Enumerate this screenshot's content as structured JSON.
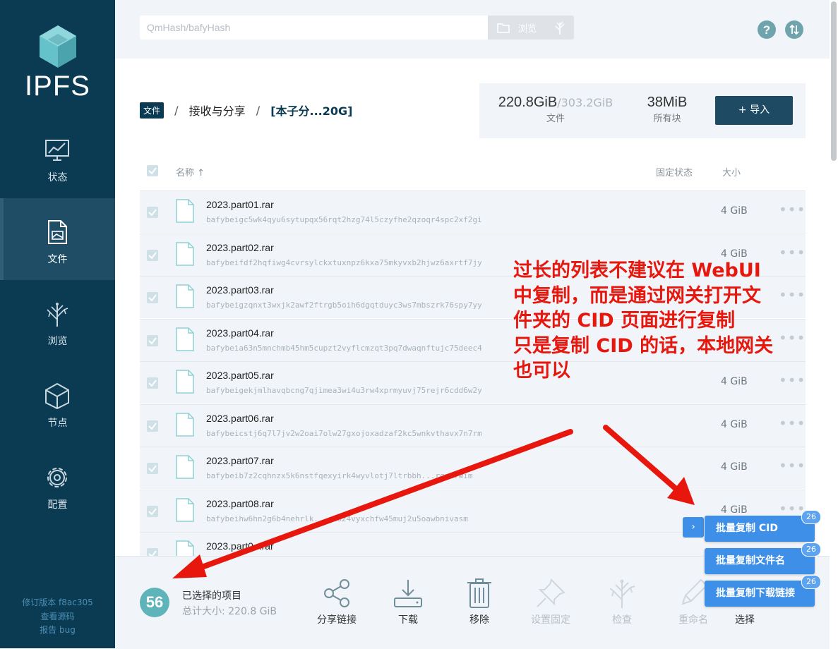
{
  "sidebar": {
    "logo_text": "IPFS",
    "items": [
      {
        "label": "状态",
        "icon": "status-chart-icon"
      },
      {
        "label": "文件",
        "icon": "file-icon"
      },
      {
        "label": "浏览",
        "icon": "tree-icon"
      },
      {
        "label": "节点",
        "icon": "cube-icon"
      },
      {
        "label": "配置",
        "icon": "gear-icon"
      }
    ],
    "version_line": "修订版本 f8ac305",
    "source_link": "查看源码",
    "bug_link": "报告 bug"
  },
  "topbar": {
    "search_placeholder": "QmHash/bafyHash",
    "browse_label": "浏览"
  },
  "breadcrumb": {
    "root": "文件",
    "sep": "/",
    "level1": "接收与分享",
    "current": "[本子分...20G]"
  },
  "stats": {
    "files_used": "220.8GiB",
    "files_total": "/303.2GiB",
    "files_label": "文件",
    "blocks_value": "38MiB",
    "blocks_label": "所有块",
    "import_label": "+ 导入"
  },
  "list_header": {
    "name": "名称 ↑",
    "pin_status": "固定状态",
    "size": "大小"
  },
  "rows": [
    {
      "name": "2023.part01.rar",
      "cid": "bafybeigc5wk4qyu6sytupqx56rqt2hzg74l5czyfhe2qzoqr4spc2xf2gi",
      "size": "4 GiB"
    },
    {
      "name": "2023.part02.rar",
      "cid": "bafybeifdf2hqfiwg4cvrsylckxtuxnpz6kxa75mkyvxb2hjwz6axrtf7jy",
      "size": "4 GiB"
    },
    {
      "name": "2023.part03.rar",
      "cid": "bafybeigzqnxt3wxjk2awf2ftrgb5oih6dgqtduyc3ws7mbszrk76spy7yy",
      "size": ""
    },
    {
      "name": "2023.part04.rar",
      "cid": "bafybeia63n5mnchmb45hm5cupzt2vyflcmzqt3pq7dwaqnftujc75deec4",
      "size": ""
    },
    {
      "name": "2023.part05.rar",
      "cid": "bafybeigekjmlhavqbcng7qjimea3wi4u3rw4xprmyuvj75rejr6cdd6w2y",
      "size": "4 GiB"
    },
    {
      "name": "2023.part06.rar",
      "cid": "bafybeicstj6q7l7jv2w2oai7olw27gxojoxadzaf2kc5wnkvthavx7n7rm",
      "size": "4 GiB"
    },
    {
      "name": "2023.part07.rar",
      "cid": "bafybeib7z2cqhnzx5k6nstfqexyirk4wyvlotj7ltrbbh...rqpt7wim",
      "size": "4 GiB"
    },
    {
      "name": "2023.part08.rar",
      "cid": "bafybeihw6hn2g6b4nehrlk...gdo24vyxchfw45muj2u5oawbnivasm",
      "size": "4 GiB"
    },
    {
      "name": "2023.part0...rar",
      "cid": "",
      "size": ""
    }
  ],
  "bottom": {
    "count": "56",
    "selected_title": "已选择的项目",
    "total_size": "总计大小: 220.8 GiB",
    "actions": [
      {
        "label": "分享链接",
        "icon": "share-icon",
        "enabled": true
      },
      {
        "label": "下载",
        "icon": "download-icon",
        "enabled": true
      },
      {
        "label": "移除",
        "icon": "trash-icon",
        "enabled": true
      },
      {
        "label": "设置固定",
        "icon": "pin-icon",
        "enabled": false
      },
      {
        "label": "检查",
        "icon": "inspect-tree-icon",
        "enabled": false
      },
      {
        "label": "重命名",
        "icon": "pencil-icon",
        "enabled": false
      },
      {
        "label": "选择",
        "icon": "select-icon",
        "enabled": true
      }
    ]
  },
  "annotation": {
    "line1": "过长的列表不建议在 WebUI",
    "line2": "中复制，而是通过网关打开文",
    "line3": "件夹的 CID 页面进行复制",
    "line4": "只是复制 CID 的话，本地网关",
    "line5": "也可以",
    "color": "#e8170e"
  },
  "popup": {
    "toggle": "›",
    "buttons": [
      {
        "label": "批量复制 CID",
        "badge": "26"
      },
      {
        "label": "批量复制文件名",
        "badge": "26"
      },
      {
        "label": "批量复制下载链接",
        "badge": "26"
      }
    ]
  },
  "colors": {
    "sidebar": "#0b3a53",
    "accent": "#5eb4ba",
    "popup": "#3d8fe8"
  }
}
